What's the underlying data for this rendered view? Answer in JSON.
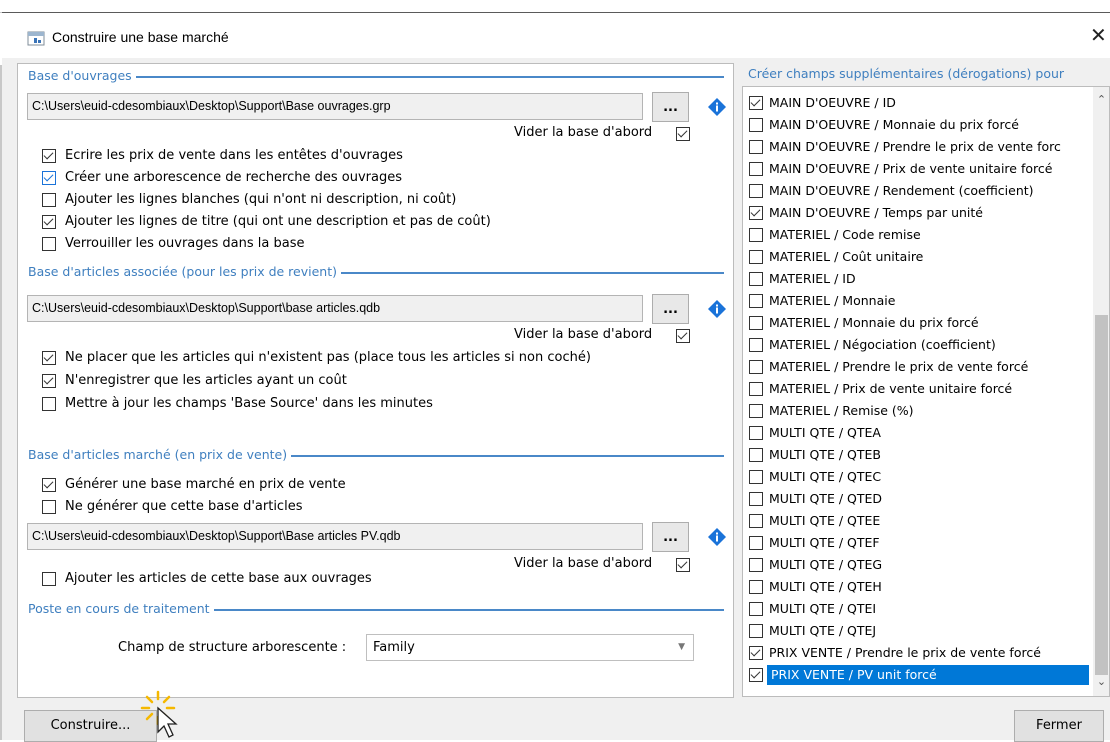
{
  "window": {
    "title": "Construire une base marché"
  },
  "groups": {
    "ouvrages": {
      "title": "Base d'ouvrages",
      "path": "C:\\Users\\euid-cdesombiaux\\Desktop\\Support\\Base ouvrages.grp",
      "browse_label": "...",
      "vider_label": "Vider la base d'abord",
      "vider_checked": true,
      "options": [
        {
          "label": "Ecrire les prix de vente dans les entêtes d'ouvrages",
          "checked": true
        },
        {
          "label": "Créer une arborescence de recherche des ouvrages",
          "checked": true
        },
        {
          "label": "Ajouter les lignes blanches (qui n'ont ni description, ni coût)",
          "checked": false
        },
        {
          "label": "Ajouter les lignes de titre (qui ont une description et pas de coût)",
          "checked": true
        },
        {
          "label": "Verrouiller les ouvrages dans la base",
          "checked": false
        }
      ]
    },
    "articles": {
      "title": "Base d'articles associée (pour les prix de revient)",
      "path": "C:\\Users\\euid-cdesombiaux\\Desktop\\Support\\base articles.qdb",
      "browse_label": "...",
      "vider_label": "Vider la base d'abord",
      "vider_checked": true,
      "options": [
        {
          "label": "Ne placer que les articles qui n'existent pas (place tous les articles si non coché)",
          "checked": true
        },
        {
          "label": "N'enregistrer que les articles ayant un coût",
          "checked": true
        },
        {
          "label": "Mettre à jour les champs 'Base Source' dans les minutes",
          "checked": false
        }
      ]
    },
    "marche": {
      "title": "Base d'articles marché (en prix de vente)",
      "options": [
        {
          "label": "Générer une base marché en prix de vente",
          "checked": true
        },
        {
          "label": "Ne générer que cette base d'articles",
          "checked": false
        }
      ],
      "path": "C:\\Users\\euid-cdesombiaux\\Desktop\\Support\\Base articles PV.qdb",
      "browse_label": "...",
      "vider_label": "Vider la base d'abord",
      "vider_checked": true,
      "extra_option": {
        "label": "Ajouter les articles de cette base aux ouvrages",
        "checked": false
      }
    },
    "poste": {
      "title": "Poste en cours de traitement",
      "combo_label": "Champ de structure arborescente :",
      "combo_value": "Family"
    }
  },
  "right": {
    "title": "Créer champs supplémentaires (dérogations) pour",
    "items": [
      {
        "label": "MAIN D'OEUVRE / ID",
        "checked": true
      },
      {
        "label": "MAIN D'OEUVRE / Monnaie du prix forcé",
        "checked": false
      },
      {
        "label": "MAIN D'OEUVRE / Prendre le prix de vente forc",
        "checked": false
      },
      {
        "label": "MAIN D'OEUVRE / Prix de vente unitaire forcé",
        "checked": false
      },
      {
        "label": "MAIN D'OEUVRE / Rendement (coefficient)",
        "checked": false
      },
      {
        "label": "MAIN D'OEUVRE / Temps par unité",
        "checked": true
      },
      {
        "label": "MATERIEL / Code remise",
        "checked": false
      },
      {
        "label": "MATERIEL / Coût unitaire",
        "checked": false
      },
      {
        "label": "MATERIEL / ID",
        "checked": false
      },
      {
        "label": "MATERIEL / Monnaie",
        "checked": false
      },
      {
        "label": "MATERIEL / Monnaie du prix forcé",
        "checked": false
      },
      {
        "label": "MATERIEL / Négociation (coefficient)",
        "checked": false
      },
      {
        "label": "MATERIEL / Prendre le prix de vente forcé",
        "checked": false
      },
      {
        "label": "MATERIEL / Prix de vente unitaire forcé",
        "checked": false
      },
      {
        "label": "MATERIEL / Remise (%)",
        "checked": false
      },
      {
        "label": "MULTI QTE / QTEA",
        "checked": false
      },
      {
        "label": "MULTI QTE / QTEB",
        "checked": false
      },
      {
        "label": "MULTI QTE / QTEC",
        "checked": false
      },
      {
        "label": "MULTI QTE / QTED",
        "checked": false
      },
      {
        "label": "MULTI QTE / QTEE",
        "checked": false
      },
      {
        "label": "MULTI QTE / QTEF",
        "checked": false
      },
      {
        "label": "MULTI QTE / QTEG",
        "checked": false
      },
      {
        "label": "MULTI QTE / QTEH",
        "checked": false
      },
      {
        "label": "MULTI QTE / QTEI",
        "checked": false
      },
      {
        "label": "MULTI QTE / QTEJ",
        "checked": false
      },
      {
        "label": "PRIX VENTE / Prendre le prix de vente forcé",
        "checked": true
      },
      {
        "label": "PRIX VENTE / PV unit forcé",
        "checked": true,
        "selected": true
      }
    ]
  },
  "buttons": {
    "build": "Construire...",
    "close": "Fermer"
  },
  "colors": {
    "group_title": "#3f7fbf",
    "selection": "#0078d7",
    "info_icon": "#1a73d9"
  }
}
